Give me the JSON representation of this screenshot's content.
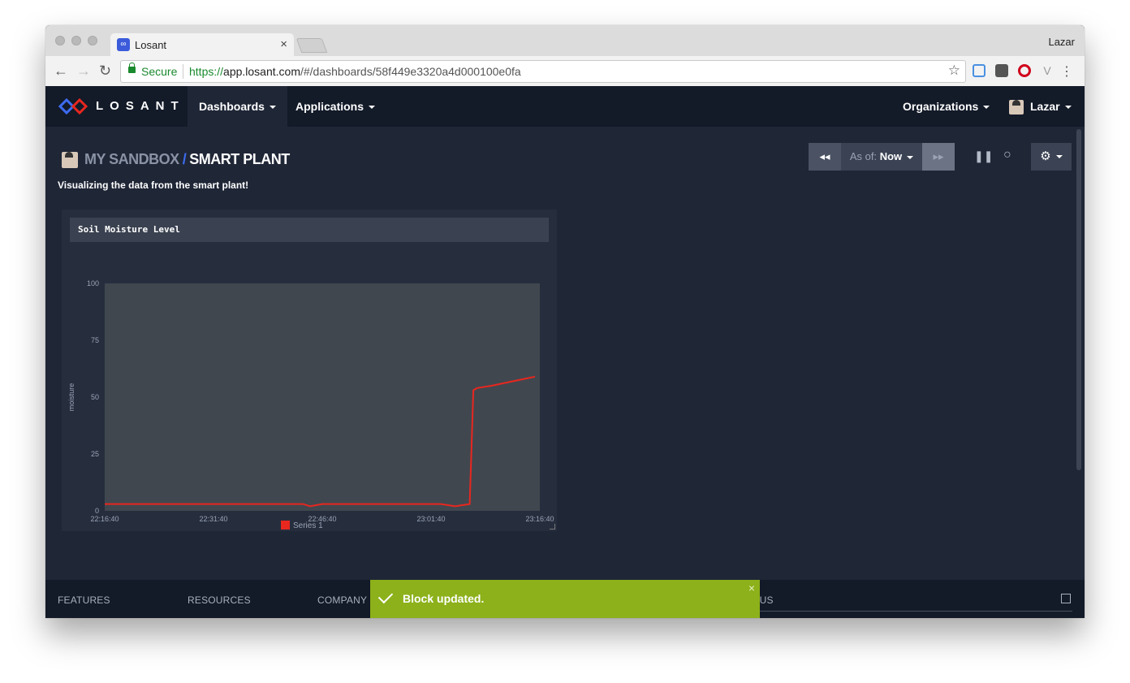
{
  "browser": {
    "tab_title": "Losant",
    "tab_close": "×",
    "profile": "Lazar",
    "secure_label": "Secure",
    "url_scheme": "https://",
    "url_host": "app.losant.com",
    "url_path": "/#/dashboards/58f449e3320a4d000100e0fa"
  },
  "nav": {
    "brand": "LOSANT",
    "items": [
      {
        "label": "Dashboards"
      },
      {
        "label": "Applications"
      }
    ],
    "organizations": "Organizations",
    "user": "Lazar"
  },
  "dashboard": {
    "breadcrumb_parent": "MY SANDBOX",
    "breadcrumb_sep": "/",
    "title": "SMART PLANT",
    "description": "Visualizing the data from the smart plant!",
    "asof_label": "As of:",
    "asof_value": "Now"
  },
  "block": {
    "title": "Soil Moisture Level"
  },
  "chart_data": {
    "type": "line",
    "title": "Soil Moisture Level",
    "xlabel": "",
    "ylabel": "moisture",
    "ylim": [
      0,
      100
    ],
    "yticks": [
      "0",
      "25",
      "50",
      "75",
      "100"
    ],
    "xticks": [
      "22:16:40",
      "22:31:40",
      "22:46:40",
      "23:01:40",
      "23:16:40"
    ],
    "series": [
      {
        "name": "Series 1",
        "color": "#e8271f",
        "x": [
          "22:16:40",
          "22:31:40",
          "22:44:00",
          "22:45:00",
          "22:46:40",
          "22:50:00",
          "22:55:00",
          "23:00:00",
          "23:03:00",
          "23:05:00",
          "23:07:00",
          "23:07:30",
          "23:08:00",
          "23:10:00",
          "23:13:00",
          "23:16:00"
        ],
        "values": [
          3,
          3,
          3,
          2,
          3,
          3,
          3,
          3,
          3,
          2,
          3,
          53,
          54,
          55,
          57,
          59
        ]
      }
    ],
    "grid": false,
    "legend": "bottom"
  },
  "footer": {
    "links": [
      "FEATURES",
      "RESOURCES",
      "COMPANY",
      "STATUS"
    ]
  },
  "toast": {
    "message": "Block updated.",
    "close": "×"
  },
  "colors": {
    "bg": "#1f2636",
    "nav": "#131a28",
    "accent": "#3d6cf0",
    "success": "#8cb11a",
    "series": "#e8271f"
  }
}
